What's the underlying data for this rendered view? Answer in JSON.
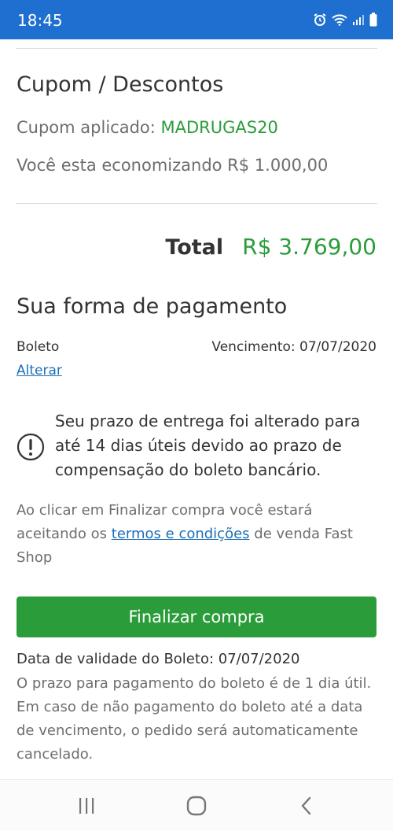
{
  "status_bar": {
    "time": "18:45",
    "icons": [
      "alarm-icon",
      "wifi-icon",
      "signal-icon",
      "battery-icon"
    ],
    "background": "#1e6fd0"
  },
  "coupon": {
    "title": "Cupom / Descontos",
    "applied_label": "Cupom aplicado:",
    "applied_code": "MADRUGAS20",
    "savings_text": "Você esta economizando R$ 1.000,00"
  },
  "total": {
    "label": "Total",
    "value": "R$ 3.769,00"
  },
  "payment": {
    "title": "Sua forma de pagamento",
    "method": "Boleto",
    "due_date": "Vencimento: 07/07/2020",
    "change_link": "Alterar"
  },
  "notice": {
    "icon": "exclamation-circle-icon",
    "text": "Seu prazo de entrega foi alterado para até 14 dias úteis devido ao prazo de compensação do boleto bancário."
  },
  "terms": {
    "prefix": "Ao clicar em Finalizar compra você estará aceitando os ",
    "link": "termos e condições",
    "suffix": " de venda Fast Shop"
  },
  "finish_button": {
    "label": "Finalizar compra",
    "color": "#2a9d3a"
  },
  "boleto": {
    "validity": "Data de validade do Boleto: 07/07/2020",
    "info": "O prazo para pagamento do boleto é de 1 dia útil. Em caso de não pagamento do boleto até a data de vencimento, o pedido será automaticamente cancelado."
  },
  "nav_bar": {
    "buttons": [
      "recent-apps-icon",
      "home-icon",
      "back-icon"
    ]
  },
  "colors": {
    "accent_green": "#2a9d3a",
    "link_blue": "#1d6fb8"
  }
}
